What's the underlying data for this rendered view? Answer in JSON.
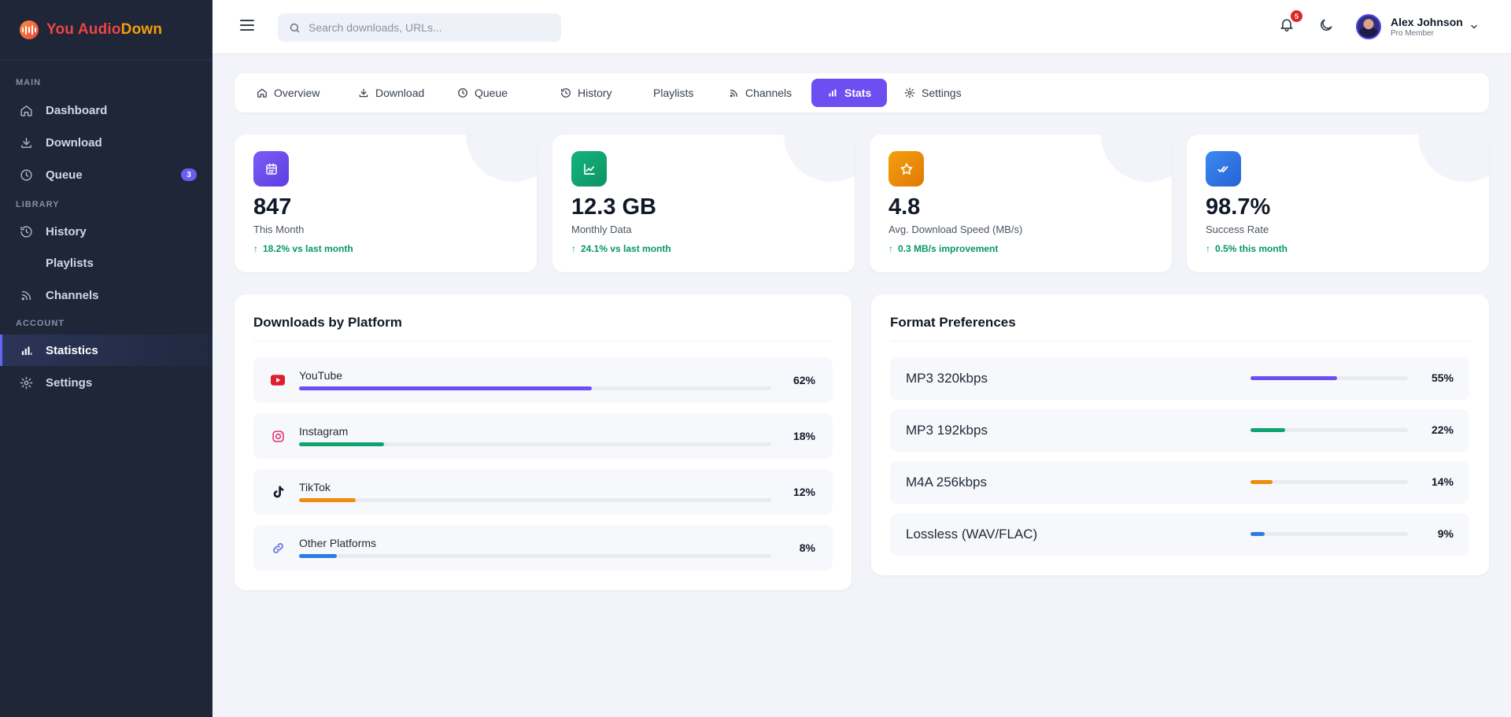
{
  "brand": {
    "part1": "You Audio",
    "part2": "Down"
  },
  "sidebar": {
    "sections": [
      "MAIN",
      "LIBRARY",
      "ACCOUNT"
    ],
    "items": [
      {
        "label": "Dashboard",
        "icon": "home-icon"
      },
      {
        "label": "Download",
        "icon": "download-icon"
      },
      {
        "label": "Queue",
        "icon": "clock-icon",
        "badge": "3"
      },
      {
        "label": "History",
        "icon": "history-icon"
      },
      {
        "label": "Playlists",
        "icon": ""
      },
      {
        "label": "Channels",
        "icon": "rss-icon"
      },
      {
        "label": "Statistics",
        "icon": "bar-chart-icon",
        "active": true
      },
      {
        "label": "Settings",
        "icon": "gear-icon"
      }
    ]
  },
  "topbar": {
    "search_placeholder": "Search downloads, URLs...",
    "notification_count": "5",
    "user": {
      "name": "Alex Johnson",
      "role": "Pro Member"
    }
  },
  "tabs": [
    {
      "label": "Overview",
      "icon": "home-icon"
    },
    {
      "label": "Download",
      "icon": "download-icon"
    },
    {
      "label": "Queue",
      "icon": "clock-icon"
    },
    {
      "label": "History",
      "icon": "history-icon"
    },
    {
      "label": "Playlists",
      "icon": ""
    },
    {
      "label": "Channels",
      "icon": "rss-icon"
    },
    {
      "label": "Stats",
      "icon": "bar-chart-icon",
      "active": true
    },
    {
      "label": "Settings",
      "icon": "gear-icon"
    }
  ],
  "stats": [
    {
      "value": "847",
      "label": "This Month",
      "change": "18.2% vs last month",
      "icon": "calendar-icon",
      "color": "#6d4ef0"
    },
    {
      "value": "12.3 GB",
      "label": "Monthly Data",
      "change": "24.1% vs last month",
      "icon": "trend-chart-icon",
      "color": "#10a36f"
    },
    {
      "value": "4.8",
      "label": "Avg. Download Speed (MB/s)",
      "change": "0.3 MB/s improvement",
      "icon": "star-icon",
      "color": "#f08c0c"
    },
    {
      "value": "98.7%",
      "label": "Success Rate",
      "change": "0.5% this month",
      "icon": "double-check-icon",
      "color": "#2f7be6"
    }
  ],
  "platforms": {
    "title": "Downloads by Platform",
    "items": [
      {
        "name": "YouTube",
        "pct": "62%",
        "value": 62,
        "icon": "youtube-icon",
        "color": "#6d4ef0"
      },
      {
        "name": "Instagram",
        "pct": "18%",
        "value": 18,
        "icon": "instagram-icon",
        "color": "#10a36f"
      },
      {
        "name": "TikTok",
        "pct": "12%",
        "value": 12,
        "icon": "tiktok-icon",
        "color": "#f08c0c"
      },
      {
        "name": "Other Platforms",
        "pct": "8%",
        "value": 8,
        "icon": "link-icon",
        "color": "#2f7be6"
      }
    ]
  },
  "formats": {
    "title": "Format Preferences",
    "items": [
      {
        "name": "MP3 320kbps",
        "pct": "55%",
        "value": 55,
        "color": "#6d4ef0"
      },
      {
        "name": "MP3 192kbps",
        "pct": "22%",
        "value": 22,
        "color": "#10a36f"
      },
      {
        "name": "M4A 256kbps",
        "pct": "14%",
        "value": 14,
        "color": "#f08c0c"
      },
      {
        "name": "Lossless (WAV/FLAC)",
        "pct": "9%",
        "value": 9,
        "color": "#2f7be6"
      }
    ]
  }
}
